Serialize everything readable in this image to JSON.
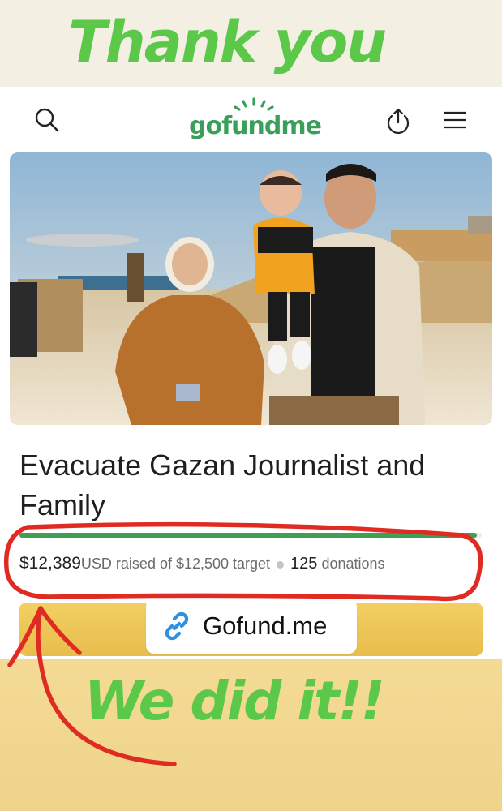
{
  "story": {
    "headline": "Thank you",
    "celebration": "We did it!!",
    "headline_color": "#5cc84a"
  },
  "header": {
    "logo_text": "gofundme",
    "brand_color": "#3a9f5b",
    "icons": [
      "search-icon",
      "share-icon",
      "menu-icon"
    ]
  },
  "campaign": {
    "title": "Evacuate Gazan Journalist and Family",
    "raised_amount": "$12,389",
    "raised_suffix": "USD raised of $12,500 target",
    "donations_count": "125",
    "donations_label": "donations",
    "progress_fraction": 0.99
  },
  "link": {
    "label": "Gofund.me",
    "icon": "link-icon",
    "icon_color": "#2f8fe0"
  },
  "annotation_color": "#e02b22"
}
